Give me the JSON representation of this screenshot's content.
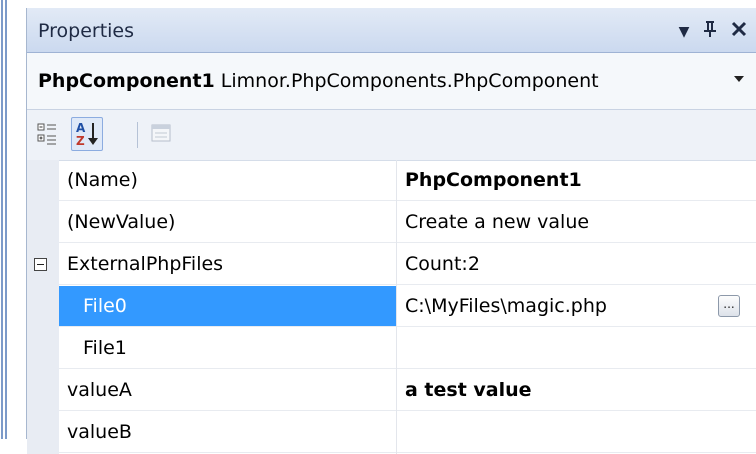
{
  "panel": {
    "title": "Properties",
    "buttons": [
      {
        "name": "dropdown-arrow",
        "icon": "▾"
      },
      {
        "name": "pin",
        "icon": "ᵽ"
      },
      {
        "name": "close",
        "icon": "✕"
      }
    ]
  },
  "selector": {
    "object_name": "PhpComponent1",
    "object_type": "Limnor.PhpComponents.PhpComponent"
  },
  "toolbar": {
    "categorized_icon": "categorized-icon",
    "alphabetical_icon": "alphabetical-sort-icon",
    "property_pages_icon": "property-pages-icon",
    "alphabetical_active": true
  },
  "grid": {
    "rows": [
      {
        "name": "(Name)",
        "value": "PhpComponent1",
        "bold": true
      },
      {
        "name": "(NewValue)",
        "value": "Create a new value"
      },
      {
        "name": "ExternalPhpFiles",
        "value": "Count:2",
        "expandable": true
      },
      {
        "name": "File0",
        "value": "C:\\MyFiles\\magic.php",
        "child": true,
        "selected": true,
        "has_button": true,
        "button_label": "..."
      },
      {
        "name": "File1",
        "value": "",
        "child": true
      },
      {
        "name": "valueA",
        "value": "a test value",
        "bold": true
      },
      {
        "name": "valueB",
        "value": ""
      }
    ]
  }
}
